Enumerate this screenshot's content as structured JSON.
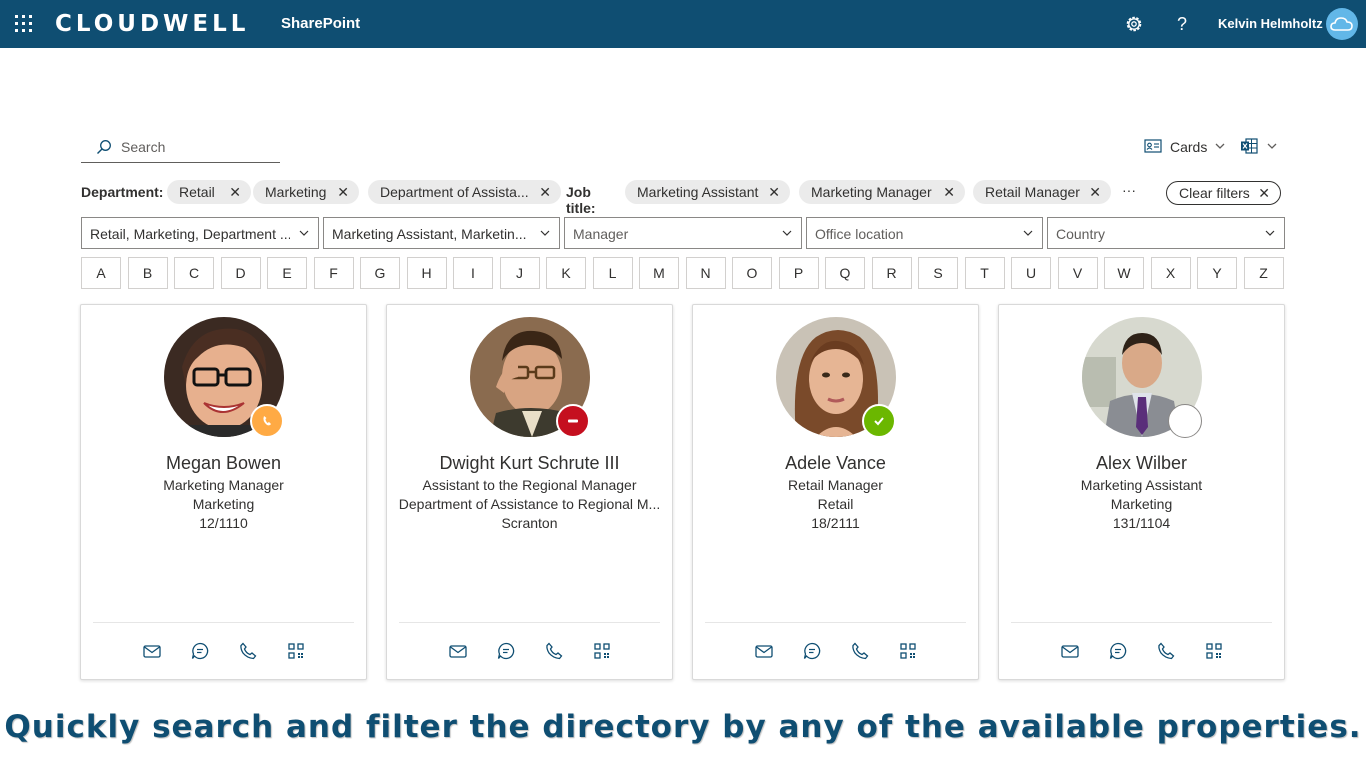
{
  "header": {
    "brand": "CLOUDWELL",
    "site": "SharePoint",
    "user_name": "Kelvin Helmholtz",
    "icons": [
      "waffle-icon",
      "gear-icon",
      "help-icon",
      "cloud-avatar-icon"
    ]
  },
  "toolbar": {
    "search_placeholder": "Search",
    "view_label": "Cards",
    "export_icon": "excel-icon"
  },
  "filters": {
    "department_label": "Department:",
    "department_pills": [
      "Retail",
      "Marketing",
      "Department of Assista..."
    ],
    "jobtitle_label": "Job title:",
    "jobtitle_pills": [
      "Marketing Assistant",
      "Marketing Manager",
      "Retail Manager"
    ],
    "more_label": "···",
    "clear_label": "Clear filters",
    "dropdowns": [
      {
        "value": "Retail, Marketing, Department ...",
        "placeholder": false
      },
      {
        "value": "Marketing Assistant, Marketin...",
        "placeholder": false
      },
      {
        "value": "Manager",
        "placeholder": true
      },
      {
        "value": "Office location",
        "placeholder": true
      },
      {
        "value": "Country",
        "placeholder": true
      }
    ]
  },
  "alphabet": [
    "A",
    "B",
    "C",
    "D",
    "E",
    "F",
    "G",
    "H",
    "I",
    "J",
    "K",
    "L",
    "M",
    "N",
    "O",
    "P",
    "Q",
    "R",
    "S",
    "T",
    "U",
    "V",
    "W",
    "X",
    "Y",
    "Z"
  ],
  "people": [
    {
      "name": "Megan Bowen",
      "title": "Marketing Manager",
      "department": "Marketing",
      "office": "12/1110",
      "presence": "away-call",
      "presence_color": "#ffaa44"
    },
    {
      "name": "Dwight Kurt Schrute III",
      "title": "Assistant to the Regional Manager",
      "department": "Department of Assistance to Regional M...",
      "office": "Scranton",
      "presence": "do-not-disturb",
      "presence_color": "#c50f1f"
    },
    {
      "name": "Adele Vance",
      "title": "Retail Manager",
      "department": "Retail",
      "office": "18/2111",
      "presence": "available",
      "presence_color": "#6bb700"
    },
    {
      "name": "Alex Wilber",
      "title": "Marketing Assistant",
      "department": "Marketing",
      "office": "131/1104",
      "presence": "offline",
      "presence_color": "#ffffff"
    }
  ],
  "card_actions": [
    "mail-icon",
    "chat-icon",
    "phone-icon",
    "qr-code-icon"
  ],
  "caption": "Quickly search and filter the directory by any of the available properties."
}
